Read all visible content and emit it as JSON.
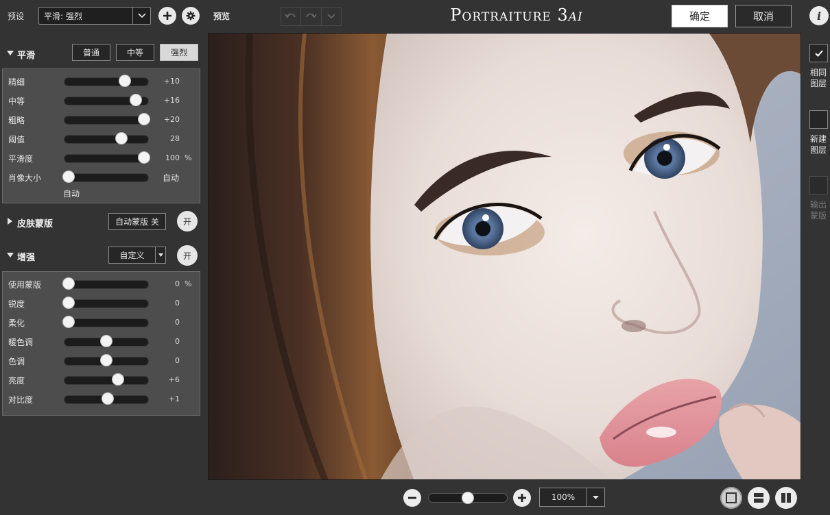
{
  "toolbar": {
    "preset_label": "预设",
    "preset_value": "平滑: 强烈",
    "preview_label": "预览",
    "app_title": "Portraiture 3",
    "app_title_suffix": "ai",
    "ok_label": "确定",
    "cancel_label": "取消"
  },
  "smoothing": {
    "title": "平滑",
    "modes": [
      "普通",
      "中等",
      "强烈"
    ],
    "active_mode": "强烈",
    "sliders": [
      {
        "label": "精细",
        "display": "+10",
        "position": 0.72,
        "unit": ""
      },
      {
        "label": "中等",
        "display": "+16",
        "position": 0.85,
        "unit": ""
      },
      {
        "label": "粗略",
        "display": "+20",
        "position": 0.94,
        "unit": ""
      },
      {
        "label": "阈值",
        "display": "28",
        "position": 0.68,
        "unit": ""
      },
      {
        "label": "平滑度",
        "display": "100",
        "position": 0.94,
        "unit": "%"
      }
    ],
    "portrait_size": {
      "label": "肖像大小",
      "value_right": "自动",
      "value_below": "自动",
      "position": 0.06
    }
  },
  "skin_mask": {
    "title": "皮肤蒙版",
    "auto_mask_label": "自动蒙版 关",
    "toggle_label": "开"
  },
  "enhance": {
    "title": "增强",
    "dropdown_value": "自定义",
    "toggle_label": "开",
    "sliders": [
      {
        "label": "使用蒙版",
        "display": "0",
        "position": 0.06,
        "unit": "%"
      },
      {
        "label": "锐度",
        "display": "0",
        "position": 0.06,
        "unit": ""
      },
      {
        "label": "柔化",
        "display": "0",
        "position": 0.06,
        "unit": ""
      },
      {
        "label": "暖色调",
        "display": "0",
        "position": 0.5,
        "unit": ""
      },
      {
        "label": "色调",
        "display": "0",
        "position": 0.5,
        "unit": ""
      },
      {
        "label": "亮度",
        "display": "+6",
        "position": 0.64,
        "unit": ""
      },
      {
        "label": "对比度",
        "display": "+1",
        "position": 0.52,
        "unit": ""
      }
    ]
  },
  "right_panel": {
    "same_layer": "相同\n图层",
    "same_layer_checked": true,
    "new_layer": "新建\n图层",
    "output_mask": "输出\n蒙版"
  },
  "bottom": {
    "zoom_value": "100%",
    "zoom_position": 0.5,
    "active_view": "single"
  },
  "colors": {
    "panel_bg": "#333333",
    "group_bg": "#4d4d4d",
    "accent_button": "#ffffff"
  }
}
